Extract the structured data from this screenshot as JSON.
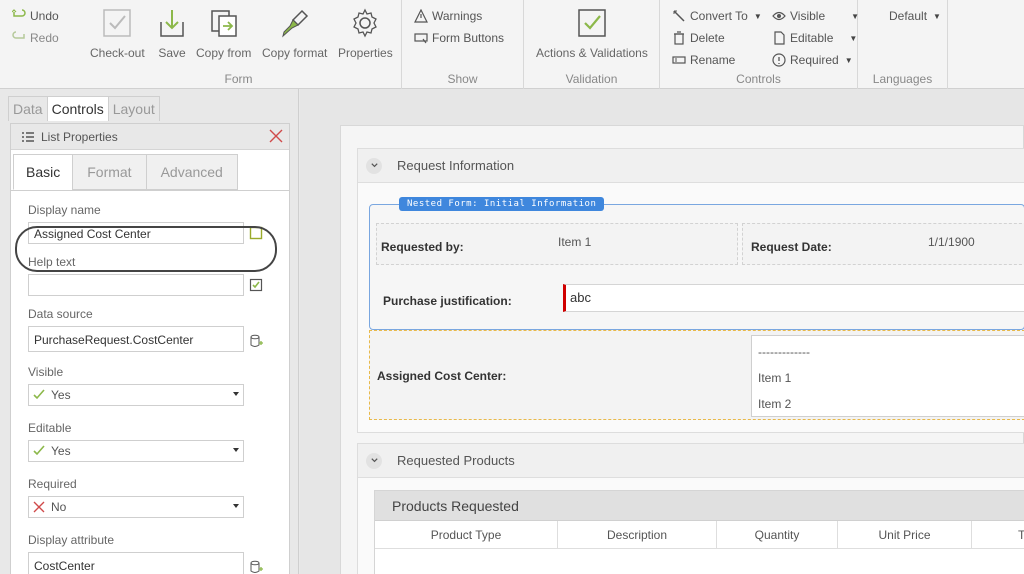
{
  "ribbon": {
    "undo": "Undo",
    "redo": "Redo",
    "form": {
      "label": "Form",
      "checkout": "Check-out",
      "save": "Save",
      "copy_from": "Copy from",
      "copy_format": "Copy format",
      "properties": "Properties"
    },
    "show": {
      "label": "Show",
      "warnings": "Warnings",
      "form_buttons": "Form Buttons"
    },
    "validation": {
      "label": "Validation",
      "actions": "Actions & Validations"
    },
    "controls": {
      "label": "Controls",
      "convert_to": "Convert To",
      "delete": "Delete",
      "rename": "Rename",
      "visible": "Visible",
      "editable": "Editable",
      "required": "Required"
    },
    "languages": {
      "label": "Languages",
      "default": "Default"
    }
  },
  "left_panel": {
    "tabs": [
      "Data",
      "Controls",
      "Layout"
    ],
    "active_tab": "Controls",
    "props_title": "List Properties",
    "subtabs": [
      "Basic",
      "Format",
      "Advanced"
    ],
    "fields": {
      "display_name_label": "Display name",
      "display_name_value": "Assigned Cost Center",
      "help_text_label": "Help text",
      "help_text_value": "",
      "data_source_label": "Data source",
      "data_source_value": "PurchaseRequest.CostCenter",
      "visible_label": "Visible",
      "visible_value": "Yes",
      "editable_label": "Editable",
      "editable_value": "Yes",
      "required_label": "Required",
      "required_value": "No",
      "display_attr_label": "Display attribute",
      "display_attr_value": "CostCenter"
    }
  },
  "form": {
    "section1_title": "Request Information",
    "nested_badge": "Nested Form: Initial Information",
    "requested_by_label": "Requested by:",
    "requested_by_value": "Item 1",
    "request_date_label": "Request Date:",
    "request_date_value": "1/1/1900",
    "justification_label": "Purchase justification:",
    "justification_value": "abc",
    "cost_center_label": "Assigned Cost Center:",
    "cost_center_items": [
      "-------------",
      "Item 1",
      "Item 2"
    ],
    "section2_title": "Requested Products",
    "grid_title": "Products Requested",
    "grid_columns": [
      "Product Type",
      "Description",
      "Quantity",
      "Unit Price",
      "To"
    ]
  },
  "colors": {
    "accent_blue": "#3f87dd",
    "required_red": "#d00000",
    "selection_orange": "#e8b94a",
    "icon_green": "#8cb84a"
  }
}
